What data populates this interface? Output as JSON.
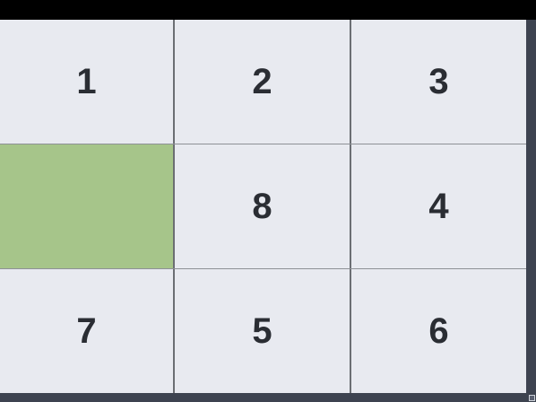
{
  "puzzle": {
    "rows": 3,
    "cols": 3,
    "tiles": [
      {
        "label": "1",
        "empty": false
      },
      {
        "label": "2",
        "empty": false
      },
      {
        "label": "3",
        "empty": false
      },
      {
        "label": "",
        "empty": true
      },
      {
        "label": "8",
        "empty": false
      },
      {
        "label": "4",
        "empty": false
      },
      {
        "label": "7",
        "empty": false
      },
      {
        "label": "5",
        "empty": false
      },
      {
        "label": "6",
        "empty": false
      }
    ]
  },
  "colors": {
    "tile_background": "#e8eaf0",
    "empty_tile": "#a6c58a",
    "text": "#2a2d33",
    "frame": "#3d4350"
  },
  "icons": {
    "corner": "resize-grip-icon"
  }
}
